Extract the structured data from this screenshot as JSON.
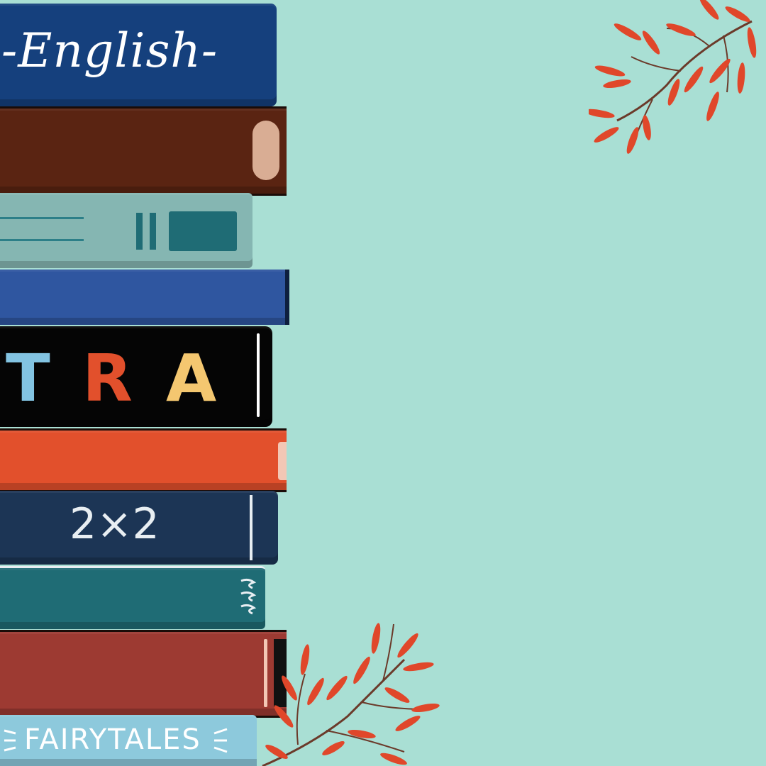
{
  "books": {
    "english": {
      "label": "-English-"
    },
    "art": {
      "letters": [
        "T",
        "R",
        "A"
      ]
    },
    "math": {
      "label": "2×2"
    },
    "fairytales": {
      "label": "FAIRYTALES"
    }
  },
  "colors": {
    "background": "#a9dfd4",
    "branch": "#e0472a",
    "stem": "#6b3a2a",
    "english_book": "#15407d",
    "brown_book": "#5a2412",
    "sage_book": "#85b6b2",
    "blue_book": "#2f56a0",
    "art_book": "#050505",
    "orange_book": "#e2502c",
    "navy_book": "#1c3555",
    "teal_book": "#1f6c75",
    "red_book": "#9d3a32",
    "light_blue_book": "#8dc9dc"
  },
  "decor": [
    "branch-top",
    "branch-bottom"
  ]
}
